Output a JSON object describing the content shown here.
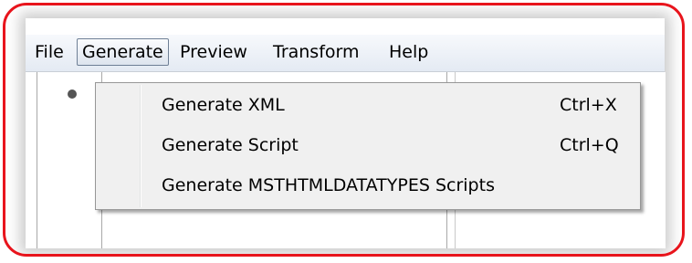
{
  "menubar": {
    "items": [
      {
        "label": "File"
      },
      {
        "label": "Generate"
      },
      {
        "label": "Preview"
      },
      {
        "label": "Transform"
      },
      {
        "label": "Help"
      }
    ],
    "open_menu": "Generate"
  },
  "generate_menu": {
    "items": [
      {
        "label": "Generate XML",
        "shortcut": "Ctrl+X"
      },
      {
        "label": "Generate Script",
        "shortcut": "Ctrl+Q"
      },
      {
        "label": "Generate MSTHTMLDATATYPES Scripts",
        "shortcut": ""
      }
    ]
  },
  "colors": {
    "highlight_frame": "#e8141c",
    "menu_background": "#f0f0f0",
    "menubar_background": "#e4eaf3"
  }
}
